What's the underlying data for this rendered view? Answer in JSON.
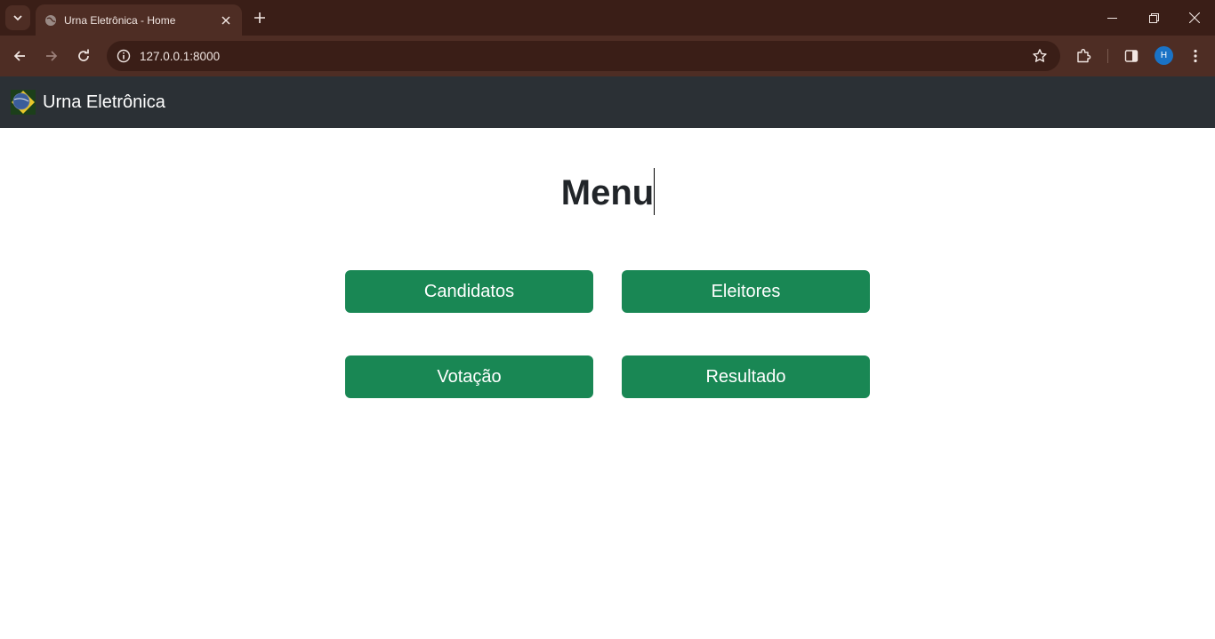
{
  "browser": {
    "tab_title": "Urna Eletrônica - Home",
    "url": "127.0.0.1:8000",
    "profile_initial": "H"
  },
  "navbar": {
    "brand": "Urna Eletrônica",
    "bg_color": "#2b3035"
  },
  "main": {
    "title": "Menu",
    "buttons": [
      {
        "label": "Candidatos"
      },
      {
        "label": "Eleitores"
      },
      {
        "label": "Votação"
      },
      {
        "label": "Resultado"
      }
    ],
    "button_color": "#198754"
  },
  "icons": {
    "tab_search": "chevron-down-icon",
    "favicon": "globe-icon",
    "tab_close": "close-icon",
    "new_tab": "plus-icon",
    "back": "arrow-left-icon",
    "forward": "arrow-right-icon",
    "reload": "reload-icon",
    "site_info": "info-icon",
    "bookmark": "star-icon",
    "extensions": "puzzle-icon",
    "side_panel": "side-panel-icon",
    "menu": "kebab-menu-icon"
  }
}
